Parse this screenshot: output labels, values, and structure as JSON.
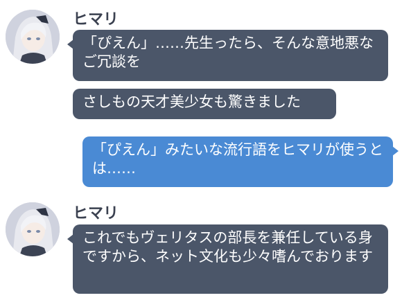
{
  "messages": {
    "first_sender": "ヒマリ",
    "second_sender": "ヒマリ",
    "npc_1": "「ぴえん」……先生ったら、そんな意地悪なご冗談を",
    "npc_2": "さしもの天才美少女も驚きました",
    "me_1": "「ぴえん」みたいな流行語をヒマリが使うとは……",
    "npc_3": "これでもヴェリタスの部長を兼任している身ですから、ネット文化も少々嗜んでおります"
  },
  "colors": {
    "npc_bubble": "#4b5669",
    "player_bubble": "#4a8ad4",
    "name_text": "#3b4150"
  }
}
